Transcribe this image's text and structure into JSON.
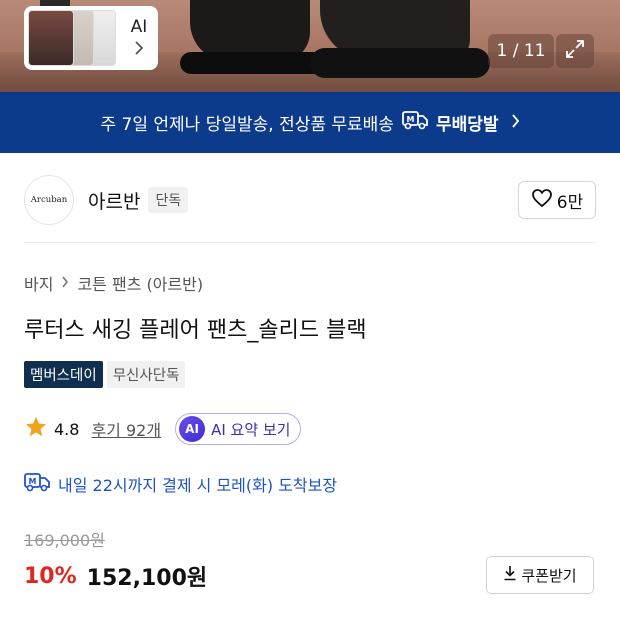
{
  "gallery": {
    "thumb_ai_label": "AI",
    "counter": "1 / 11"
  },
  "shipping_banner": {
    "text": "주 7일 언제나 당일발송, 전상품 무료배송",
    "badge": "무배당발"
  },
  "brand": {
    "logo_text": "Arcuban",
    "name": "아르반",
    "badge": "단독",
    "likes": "6만"
  },
  "breadcrumb": [
    "바지",
    "코튼 팬츠 (아르반)"
  ],
  "product": {
    "title": "루터스 새깅 플레어 팬츠_솔리드 블랙",
    "tags": [
      "멤버스데이",
      "무신사단독"
    ]
  },
  "rating": {
    "value": "4.8",
    "reviews": "후기 92개",
    "ai_badge": "AI",
    "ai_summary": "AI 요약 보기"
  },
  "delivery": {
    "text": "내일 22시까지 결제 시 모레(화) 도착보장"
  },
  "price": {
    "original": "169,000원",
    "discount": "10%",
    "final": "152,100원",
    "coupon": "쿠폰받기"
  },
  "colors": {
    "banner": "#0d3b8c",
    "discount": "#e0271f",
    "delivery": "#1d53c9",
    "star": "#f0a31c"
  }
}
